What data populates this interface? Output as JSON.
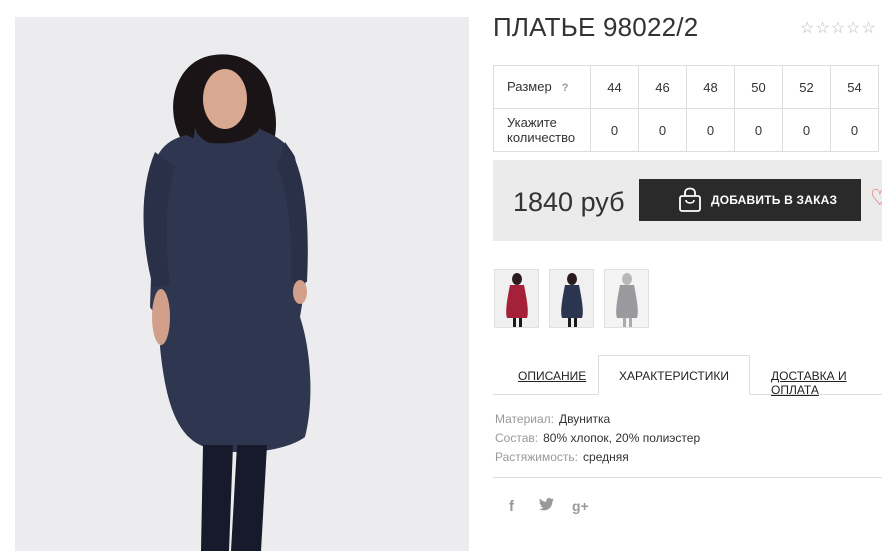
{
  "product": {
    "title": "ПЛАТЬЕ 98022/2",
    "rating_stars": "☆☆☆☆☆"
  },
  "size_table": {
    "size_label": "Размер",
    "help_mark": "?",
    "qty_label": "Укажите количество",
    "sizes": [
      "44",
      "46",
      "48",
      "50",
      "52",
      "54"
    ],
    "quantities": [
      "0",
      "0",
      "0",
      "0",
      "0",
      "0"
    ]
  },
  "buy": {
    "price": "1840 руб",
    "order_button": "ДОБАВИТЬ В ЗАКАЗ"
  },
  "thumbnails": [
    {
      "color": "#a5213a"
    },
    {
      "color": "#2c3550"
    },
    {
      "color": "#9a9a9e"
    }
  ],
  "tabs": {
    "description": "ОПИСАНИЕ",
    "characteristics": "ХАРАКТЕРИСТИКИ",
    "delivery": "ДОСТАВКА И ОПЛАТА"
  },
  "specs": [
    {
      "key": "Материал:",
      "value": "Двунитка"
    },
    {
      "key": "Состав:",
      "value": "80% хлопок, 20% полиэстер"
    },
    {
      "key": "Растяжимость:",
      "value": "средняя"
    }
  ],
  "social": {
    "facebook": "f",
    "twitter": "🐦",
    "googleplus": "g+"
  },
  "colors": {
    "dress": "#2f3650",
    "button_bg": "#2a2a2a",
    "buybox_bg": "#ebebeb",
    "heart": "#e06060"
  }
}
